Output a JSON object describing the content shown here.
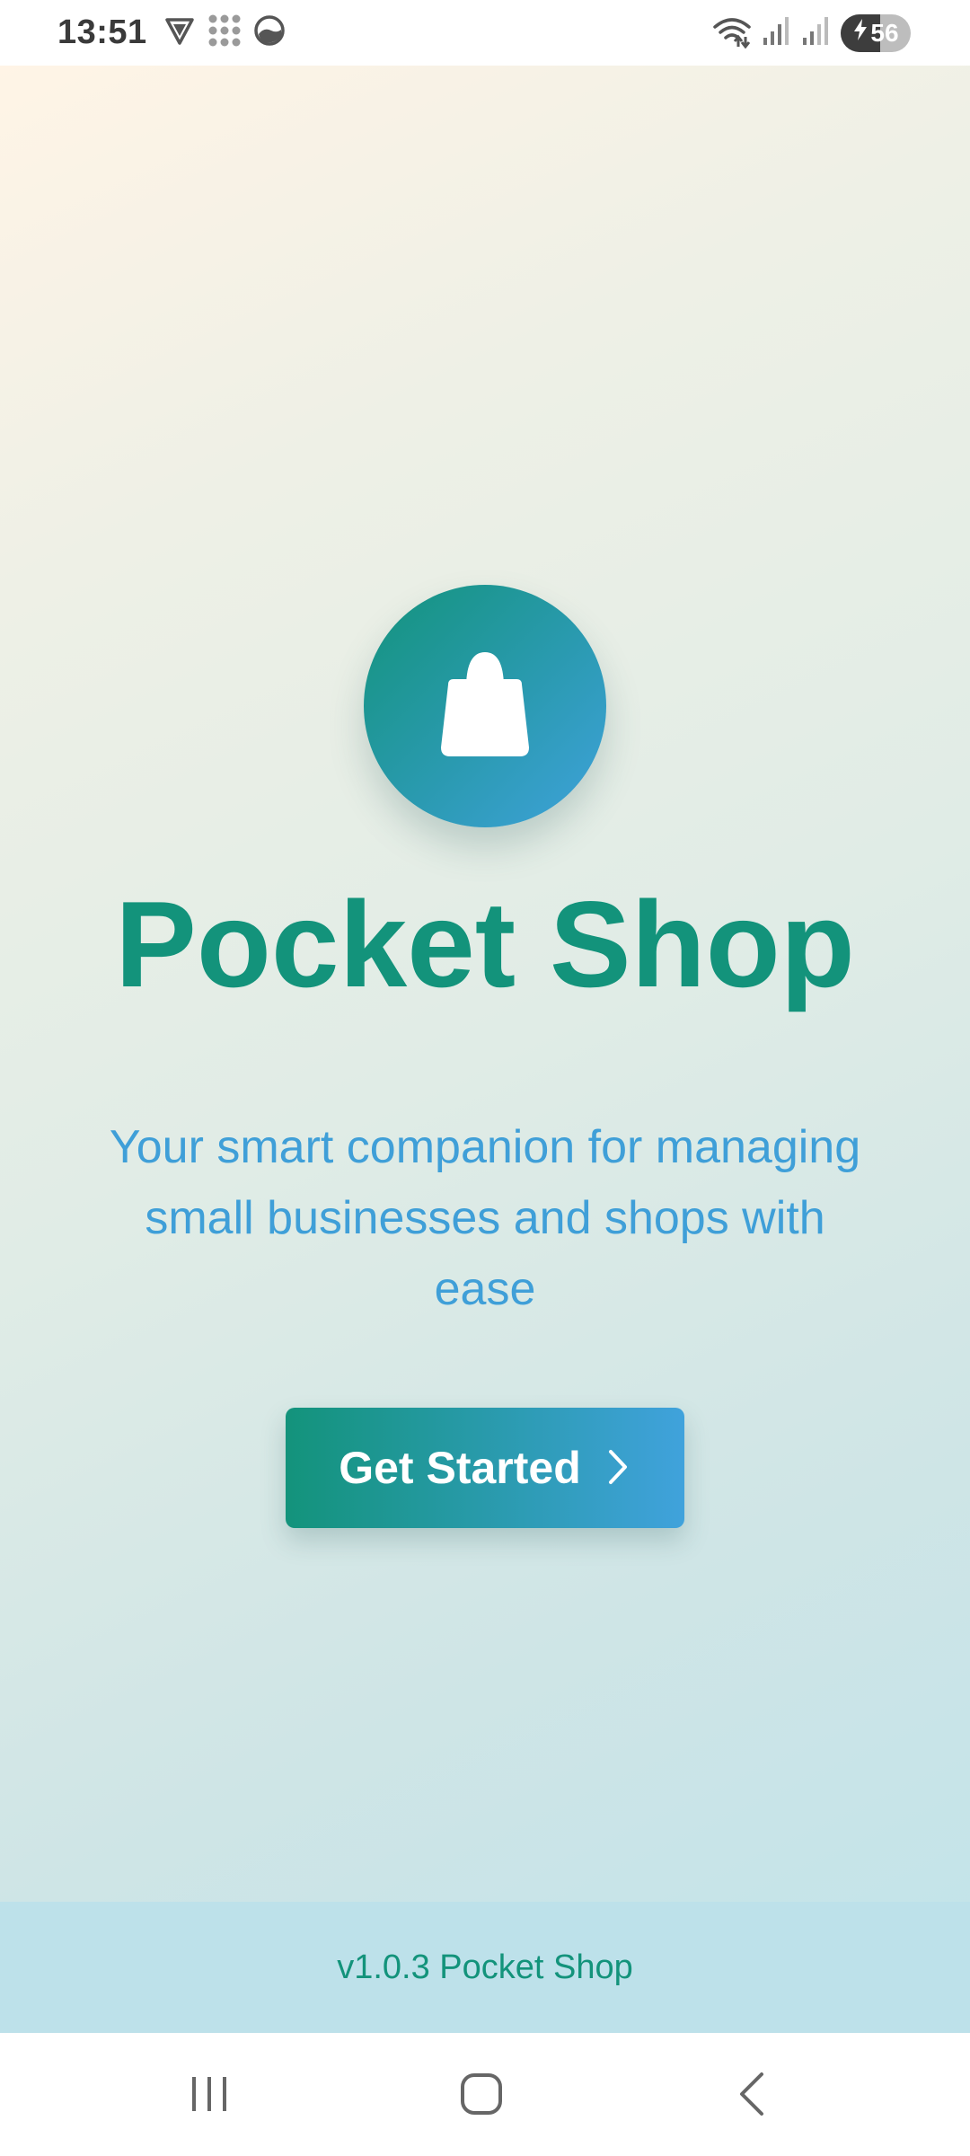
{
  "status_bar": {
    "time": "13:51",
    "battery_level": "56",
    "icons": [
      "vpn-shield-icon",
      "app-grid-icon",
      "weather-icon",
      "wifi-icon",
      "signal-icon",
      "signal-icon",
      "battery-charging-icon"
    ]
  },
  "app": {
    "logo_icon": "shopping-bag-icon",
    "title": "Pocket Shop",
    "tagline": "Your smart companion for managing small businesses and shops with ease",
    "cta_label": "Get Started",
    "cta_icon": "chevron-right-icon",
    "footer": "v1.0.3 Pocket Shop"
  },
  "nav_bar": {
    "buttons": [
      "recent-apps-icon",
      "home-icon",
      "back-icon"
    ]
  },
  "colors": {
    "brand_green": "#13937b",
    "brand_blue": "#3f9fd8",
    "footer_bg": "#bde1ea"
  }
}
